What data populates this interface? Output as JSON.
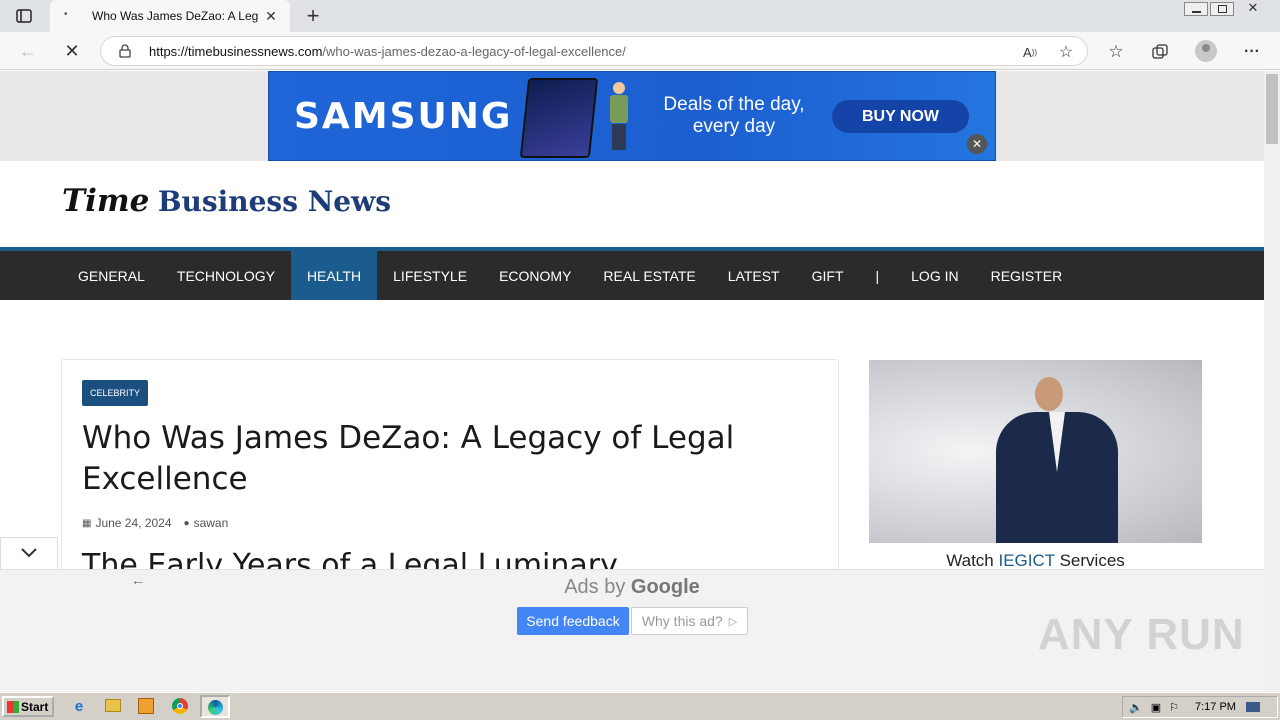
{
  "browser": {
    "tab_title": "Who Was James DeZao: A Legal",
    "url_domain": "https://timebusinessnews.com",
    "url_path": "/who-was-james-dezao-a-legacy-of-legal-excellence/"
  },
  "top_ad": {
    "brand": "SAMSUNG",
    "tagline_line1": "Deals of the day,",
    "tagline_line2": "every day",
    "cta": "BUY NOW"
  },
  "site": {
    "logo_time": "Time",
    "logo_business_news": "Business News"
  },
  "nav": {
    "items": [
      "GENERAL",
      "TECHNOLOGY",
      "HEALTH",
      "LIFESTYLE",
      "ECONOMY",
      "REAL ESTATE",
      "LATEST",
      "GIFT"
    ],
    "separator": "|",
    "login": "LOG IN",
    "register": "REGISTER",
    "active": "HEALTH"
  },
  "article": {
    "category": "CELEBRITY",
    "title_line1": "Who Was James DeZao: A Legacy of Legal",
    "title_line2": "Excellence",
    "date": "June 24, 2024",
    "author": "sawan",
    "subheading": "The Early Years of a Legal Luminary"
  },
  "side_ad": {
    "caption_prefix": "Watch ",
    "caption_link": "IEGICT",
    "caption_suffix": " Services"
  },
  "bottom_ad": {
    "ads_by": "Ads by ",
    "google": "Google",
    "send_feedback": "Send feedback",
    "why_this_ad": "Why this ad?"
  },
  "taskbar": {
    "start": "Start",
    "time": "7:17 PM"
  },
  "watermark": "ANY RUN",
  "colors": {
    "nav_bg": "#2b2b2b",
    "nav_active": "#1b5c8f",
    "brand_blue": "#1d3c78",
    "samsung_blue": "#1e65d8"
  }
}
